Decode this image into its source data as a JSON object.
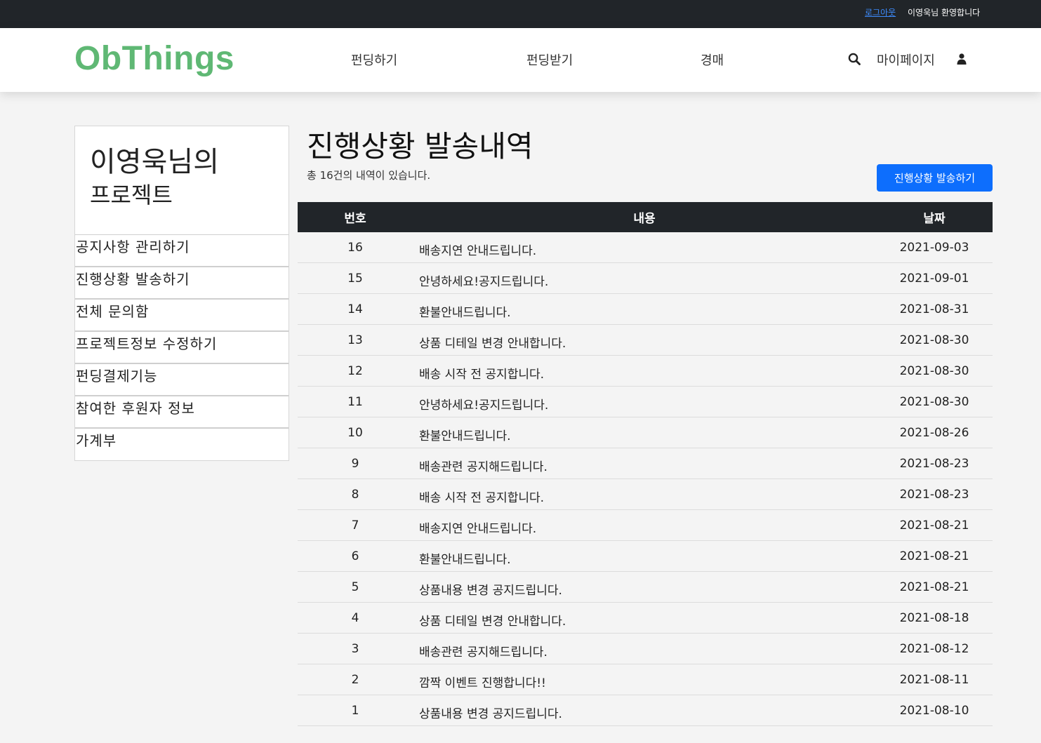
{
  "topbar": {
    "logout_label": "로그아웃",
    "welcome_text": "이영욱님 환영합니다"
  },
  "header": {
    "logo": "ObThings",
    "nav": {
      "fund": "펀딩하기",
      "receive": "펀딩받기",
      "auction": "경매"
    },
    "mypage_label": "마이페이지",
    "icons": {
      "search": "search-icon",
      "user": "user-icon"
    }
  },
  "sidebar": {
    "title_line1": "이영욱님의",
    "title_line2": "프로젝트",
    "items": [
      "공지사항 관리하기",
      "진행상황 발송하기",
      "전체 문의함",
      "프로젝트정보 수정하기",
      "펀딩결제기능",
      "참여한 후원자 정보",
      "가계부"
    ]
  },
  "main": {
    "title": "진행상황 발송내역",
    "total_text": "총 16건의 내역이 있습니다.",
    "send_button": "진행상황 발송하기",
    "table": {
      "headers": {
        "no": "번호",
        "content": "내용",
        "date": "날짜"
      },
      "rows": [
        {
          "no": "16",
          "content": "배송지연 안내드립니다.",
          "date": "2021-09-03"
        },
        {
          "no": "15",
          "content": "안녕하세요!공지드립니다.",
          "date": "2021-09-01"
        },
        {
          "no": "14",
          "content": "환불안내드립니다.",
          "date": "2021-08-31"
        },
        {
          "no": "13",
          "content": "상품 디테일 변경 안내합니다.",
          "date": "2021-08-30"
        },
        {
          "no": "12",
          "content": "배송 시작 전 공지합니다.",
          "date": "2021-08-30"
        },
        {
          "no": "11",
          "content": "안녕하세요!공지드립니다.",
          "date": "2021-08-30"
        },
        {
          "no": "10",
          "content": "환불안내드립니다.",
          "date": "2021-08-26"
        },
        {
          "no": "9",
          "content": "배송관련 공지해드립니다.",
          "date": "2021-08-23"
        },
        {
          "no": "8",
          "content": "배송 시작 전 공지합니다.",
          "date": "2021-08-23"
        },
        {
          "no": "7",
          "content": "배송지연 안내드립니다.",
          "date": "2021-08-21"
        },
        {
          "no": "6",
          "content": "환불안내드립니다.",
          "date": "2021-08-21"
        },
        {
          "no": "5",
          "content": "상품내용 변경 공지드립니다.",
          "date": "2021-08-21"
        },
        {
          "no": "4",
          "content": "상품 디테일 변경 안내합니다.",
          "date": "2021-08-18"
        },
        {
          "no": "3",
          "content": "배송관련 공지해드립니다.",
          "date": "2021-08-12"
        },
        {
          "no": "2",
          "content": "깜짝 이벤트 진행합니다!!",
          "date": "2021-08-11"
        },
        {
          "no": "1",
          "content": "상품내용 변경 공지드립니다.",
          "date": "2021-08-10"
        }
      ]
    }
  },
  "colors": {
    "topbar_bg": "#212529",
    "logo": "#5fb874",
    "primary_button": "#0d6efd",
    "table_header_bg": "#212529"
  }
}
